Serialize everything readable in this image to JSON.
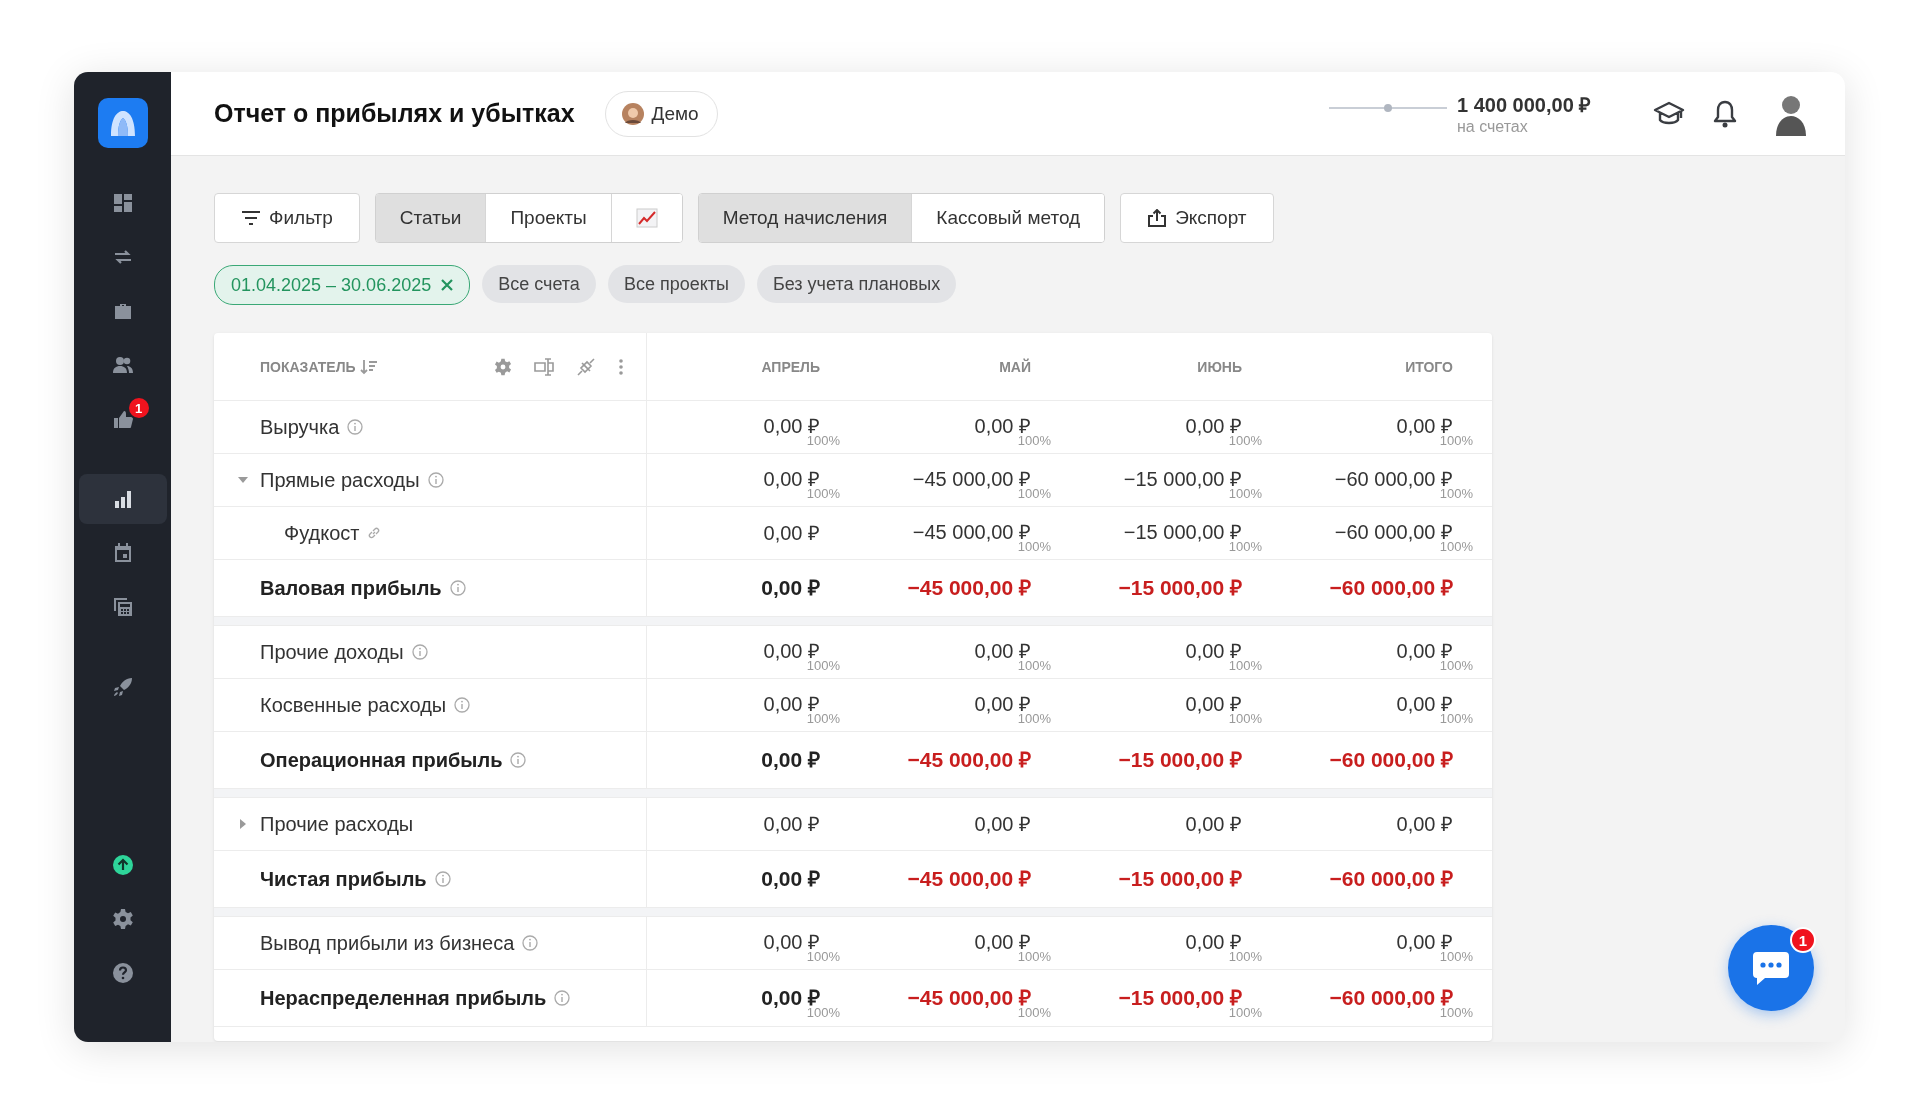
{
  "header": {
    "title": "Отчет о прибылях и убытках",
    "demo": {
      "label": "Демо"
    },
    "balance": {
      "amount": "1 400 000,00 ₽",
      "caption": "на счетах",
      "level": 0.5
    }
  },
  "sidebar": {
    "sections": [
      [
        {
          "selected": false
        },
        {
          "selected": false
        },
        {
          "selected": false
        },
        {
          "selected": false
        },
        {
          "selected": false,
          "badge": "1"
        }
      ],
      [
        {
          "selected": true
        },
        {
          "selected": false
        },
        {
          "selected": false
        }
      ],
      [
        {
          "selected": false
        }
      ]
    ],
    "footer": [
      {
        "selected": false
      },
      {
        "selected": false
      },
      {
        "selected": false
      }
    ]
  },
  "toolbar": {
    "filter": "Фильтр",
    "views": [
      {
        "kind": "text",
        "label": "Статьи",
        "selected": true
      },
      {
        "kind": "text",
        "label": "Проекты",
        "selected": false
      },
      {
        "kind": "chart",
        "selected": false
      }
    ],
    "methods": [
      {
        "label": "Метод начисления",
        "selected": true
      },
      {
        "label": "Кассовый метод",
        "selected": false
      }
    ],
    "export": "Экспорт"
  },
  "chips": [
    {
      "kind": "date",
      "label": "01.04.2025 – 30.06.2025"
    },
    {
      "kind": "plain",
      "label": "Все счета"
    },
    {
      "kind": "plain",
      "label": "Все проекты"
    },
    {
      "kind": "plain",
      "label": "Без учета плановых"
    }
  ],
  "table": {
    "name_column": "ПОКАЗАТЕЛЬ",
    "columns": [
      "АПРЕЛЬ",
      "МАЙ",
      "ИЮНЬ",
      "ИТОГО"
    ],
    "rows": [
      {
        "kind": "item",
        "label": "Выручка",
        "hint": true,
        "cells": [
          {
            "value": "0,00 ₽",
            "share": "100%"
          },
          {
            "value": "0,00 ₽",
            "share": "100%"
          },
          {
            "value": "0,00 ₽",
            "share": "100%"
          },
          {
            "value": "0,00 ₽",
            "share": "100%"
          }
        ]
      },
      {
        "kind": "group",
        "label": "Прямые расходы",
        "hint": true,
        "expanded": true,
        "cells": [
          {
            "value": "0,00 ₽",
            "share": "100%"
          },
          {
            "value": "−45 000,00 ₽",
            "share": "100%"
          },
          {
            "value": "−15 000,00 ₽",
            "share": "100%"
          },
          {
            "value": "−60 000,00 ₽",
            "share": "100%"
          }
        ]
      },
      {
        "kind": "child",
        "label": "Фудкост",
        "hint": true,
        "cells": [
          {
            "value": "0,00 ₽"
          },
          {
            "value": "−45 000,00 ₽",
            "share": "100%"
          },
          {
            "value": "−15 000,00 ₽",
            "share": "100%"
          },
          {
            "value": "−60 000,00 ₽",
            "share": "100%"
          }
        ]
      },
      {
        "kind": "total",
        "label": "Валовая прибыль",
        "hint": true,
        "cells": [
          {
            "value": "0,00 ₽",
            "loss": false
          },
          {
            "value": "−45 000,00 ₽",
            "loss": true
          },
          {
            "value": "−15 000,00 ₽",
            "loss": true
          },
          {
            "value": "−60 000,00 ₽",
            "loss": true
          }
        ]
      },
      {
        "kind": "item",
        "label": "Прочие доходы",
        "hint": true,
        "cells": [
          {
            "value": "0,00 ₽",
            "share": "100%"
          },
          {
            "value": "0,00 ₽",
            "share": "100%"
          },
          {
            "value": "0,00 ₽",
            "share": "100%"
          },
          {
            "value": "0,00 ₽",
            "share": "100%"
          }
        ]
      },
      {
        "kind": "item",
        "label": "Косвенные расходы",
        "hint": true,
        "cells": [
          {
            "value": "0,00 ₽",
            "share": "100%"
          },
          {
            "value": "0,00 ₽",
            "share": "100%"
          },
          {
            "value": "0,00 ₽",
            "share": "100%"
          },
          {
            "value": "0,00 ₽",
            "share": "100%"
          }
        ]
      },
      {
        "kind": "total",
        "label": "Операционная прибыль",
        "hint": true,
        "cells": [
          {
            "value": "0,00 ₽",
            "loss": false
          },
          {
            "value": "−45 000,00 ₽",
            "loss": true
          },
          {
            "value": "−15 000,00 ₽",
            "loss": true
          },
          {
            "value": "−60 000,00 ₽",
            "loss": true
          }
        ]
      },
      {
        "kind": "group",
        "label": "Прочие расходы",
        "hint": false,
        "expanded": false,
        "cells": [
          {
            "value": "0,00 ₽"
          },
          {
            "value": "0,00 ₽"
          },
          {
            "value": "0,00 ₽"
          },
          {
            "value": "0,00 ₽"
          }
        ]
      },
      {
        "kind": "total",
        "label": "Чистая прибыль",
        "hint": true,
        "cells": [
          {
            "value": "0,00 ₽",
            "loss": false
          },
          {
            "value": "−45 000,00 ₽",
            "loss": true
          },
          {
            "value": "−15 000,00 ₽",
            "loss": true
          },
          {
            "value": "−60 000,00 ₽",
            "loss": true
          }
        ]
      },
      {
        "kind": "item",
        "label": "Вывод прибыли из бизнеса",
        "hint": true,
        "cells": [
          {
            "value": "0,00 ₽",
            "share": "100%"
          },
          {
            "value": "0,00 ₽",
            "share": "100%"
          },
          {
            "value": "0,00 ₽",
            "share": "100%"
          },
          {
            "value": "0,00 ₽",
            "share": "100%"
          }
        ]
      },
      {
        "kind": "total",
        "label": "Нераспределенная прибыль",
        "hint": true,
        "cells": [
          {
            "value": "0,00 ₽",
            "share": "100%",
            "loss": false
          },
          {
            "value": "−45 000,00 ₽",
            "share": "100%",
            "loss": true
          },
          {
            "value": "−15 000,00 ₽",
            "share": "100%",
            "loss": true
          },
          {
            "value": "−60 000,00 ₽",
            "share": "100%",
            "loss": true
          }
        ]
      }
    ]
  },
  "chat": {
    "badge": "1"
  }
}
